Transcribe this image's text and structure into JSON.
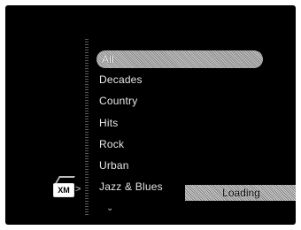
{
  "menu": {
    "items": [
      {
        "label": "All",
        "selected": true
      },
      {
        "label": "Decades"
      },
      {
        "label": "Country"
      },
      {
        "label": "Hits"
      },
      {
        "label": "Rock"
      },
      {
        "label": "Urban"
      },
      {
        "label": "Jazz & Blues"
      }
    ],
    "more_indicator": "⌄"
  },
  "status": {
    "text": "Loading"
  },
  "logo": {
    "text": "XM"
  },
  "source_arrow": ">",
  "colors": {
    "background": "#000000",
    "text": "#e6e6e6",
    "highlight": "#a8a8a8"
  }
}
